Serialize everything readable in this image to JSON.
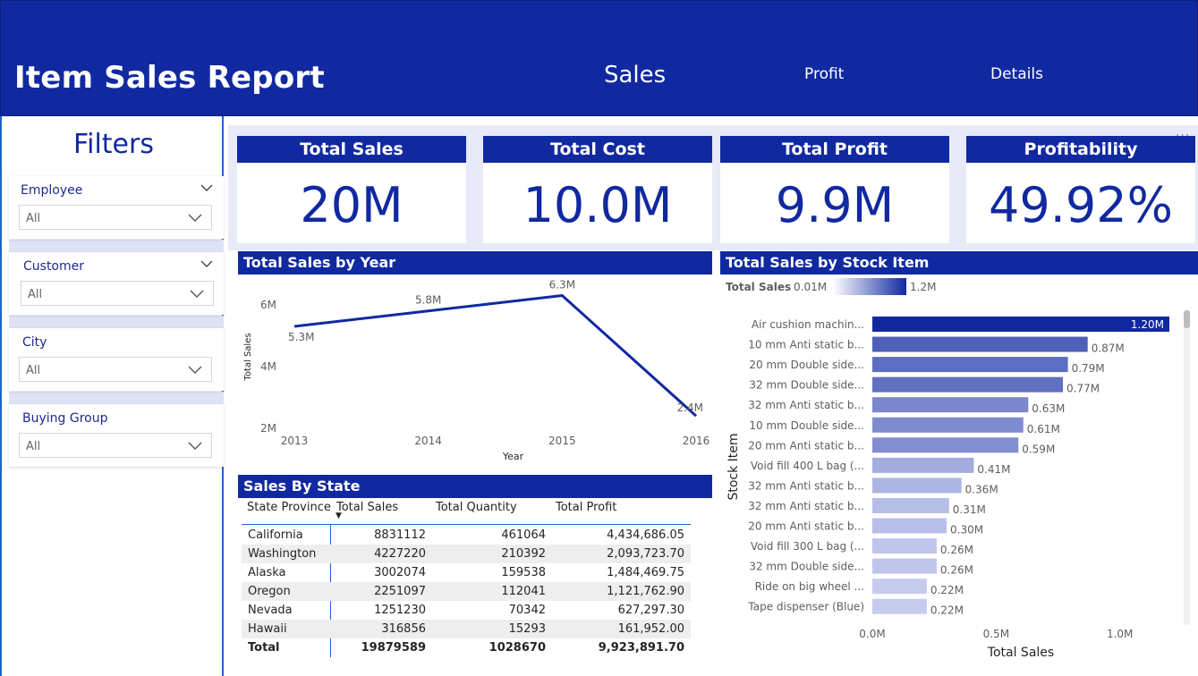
{
  "header": {
    "title": "Item Sales Report",
    "nav": {
      "sales": "Sales",
      "profit": "Profit",
      "details": "Details"
    }
  },
  "filters": {
    "title": "Filters",
    "slicers": [
      {
        "label": "Employee",
        "value": "All"
      },
      {
        "label": "Customer",
        "value": "All"
      },
      {
        "label": "City",
        "value": "All"
      },
      {
        "label": "Buying Group",
        "value": "All"
      }
    ]
  },
  "kpis": [
    {
      "title": "Total Sales",
      "value": "20M"
    },
    {
      "title": "Total Cost",
      "value": "10.0M"
    },
    {
      "title": "Total Profit",
      "value": "9.9M"
    },
    {
      "title": "Profitability",
      "value": "49.92%"
    }
  ],
  "more_options": "...",
  "chart_data": [
    {
      "type": "line",
      "title": "Total Sales by Year",
      "xlabel": "Year",
      "ylabel": "Total Sales",
      "x": [
        2013,
        2014,
        2015,
        2016
      ],
      "x_tick_labels": [
        "2013",
        "2014",
        "2015",
        "2016"
      ],
      "y_tick_labels": [
        "6M",
        "4M",
        "2M"
      ],
      "y_ticks": [
        6000000,
        4000000,
        2000000
      ],
      "ylim": [
        2000000,
        6400000
      ],
      "series": [
        {
          "values": [
            5300000,
            5800000,
            6300000,
            2400000
          ],
          "data_labels": [
            "5.3M",
            "5.8M",
            "6.3M",
            "2.4M"
          ]
        }
      ],
      "color": "#1129A0",
      "grid": false
    },
    {
      "type": "bar",
      "orientation": "horizontal",
      "title": "Total Sales by Stock Item",
      "xlabel": "Total Sales",
      "ylabel": "Stock Item",
      "legend": {
        "label": "Total Sales",
        "min_label": "0.01M",
        "max_label": "1.2M",
        "position": "top-left"
      },
      "categories": [
        "Air cushion machin...",
        "10 mm Anti static b...",
        "20 mm Double side...",
        "32 mm Double side...",
        "32 mm Anti static b...",
        "10 mm Double side...",
        "20 mm Anti static b...",
        "Void fill 400 L bag (...",
        "32 mm Anti static b...",
        "32 mm Anti static b...",
        "20 mm Anti static b...",
        "Void fill 300 L bag (...",
        "32 mm Double side...",
        "Ride on big wheel ...",
        "Tape dispenser (Blue)"
      ],
      "values": [
        1200000,
        870000,
        790000,
        770000,
        630000,
        610000,
        590000,
        410000,
        360000,
        310000,
        300000,
        260000,
        260000,
        220000,
        220000
      ],
      "data_labels": [
        "1.20M",
        "0.87M",
        "0.79M",
        "0.77M",
        "0.63M",
        "0.61M",
        "0.59M",
        "0.41M",
        "0.36M",
        "0.31M",
        "0.30M",
        "0.26M",
        "0.26M",
        "0.22M",
        "0.22M"
      ],
      "x_ticks": [
        0,
        500000,
        1000000
      ],
      "x_tick_labels": [
        "0.0M",
        "0.5M",
        "1.0M"
      ],
      "xlim": [
        0,
        1200000
      ],
      "color_min": "#c7ccee",
      "color_max": "#1129A0"
    },
    {
      "type": "table",
      "title": "Sales By State",
      "columns": [
        "State Province",
        "Total Sales",
        "Total Quantity",
        "Total Profit"
      ],
      "sort_indicator": "▼",
      "rows": [
        [
          "California",
          "8831112",
          "461064",
          "4,434,686.05"
        ],
        [
          "Washington",
          "4227220",
          "210392",
          "2,093,723.70"
        ],
        [
          "Alaska",
          "3002074",
          "159538",
          "1,484,469.75"
        ],
        [
          "Oregon",
          "2251097",
          "112041",
          "1,121,762.90"
        ],
        [
          "Nevada",
          "1251230",
          "70342",
          "627,297.30"
        ],
        [
          "Hawaii",
          "316856",
          "15293",
          "161,952.00"
        ]
      ],
      "total": [
        "Total",
        "19879589",
        "1028670",
        "9,923,891.70"
      ]
    }
  ],
  "colors": {
    "brand": "#1129A0",
    "band": "#e9eaf7",
    "slicer_border": "#1c65c8"
  }
}
